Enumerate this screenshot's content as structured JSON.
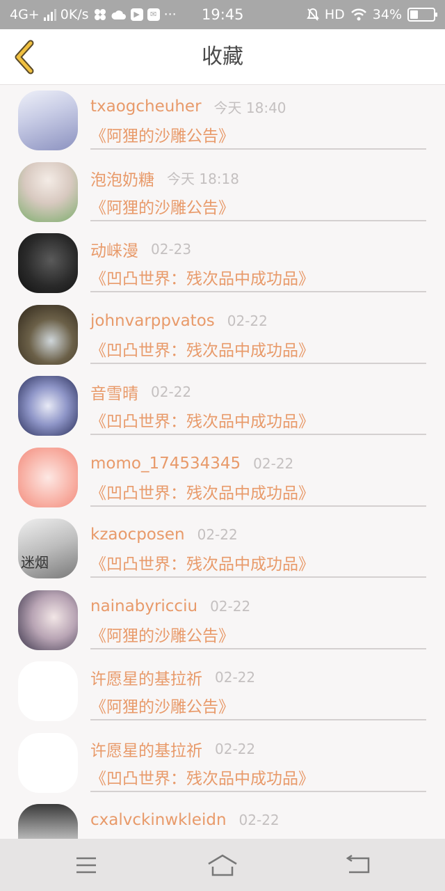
{
  "status_bar": {
    "network": "4G+",
    "speed": "0K/s",
    "more": "···",
    "time": "19:45",
    "hd": "HD",
    "battery": "34%",
    "battery_level": 0.34
  },
  "header": {
    "title": "收藏"
  },
  "favorites": [
    {
      "name": "txaogcheuher",
      "time": "今天 18:40",
      "work": "《阿狸的沙雕公告》",
      "avatar": "grad-a"
    },
    {
      "name": "泡泡奶糖",
      "time": "今天 18:18",
      "work": "《阿狸的沙雕公告》",
      "avatar": "grad-b"
    },
    {
      "name": "动崃漫",
      "time": "02-23",
      "work": "《凹凸世界：残次品中成功品》",
      "avatar": "grad-c"
    },
    {
      "name": "johnvarppvatos",
      "time": "02-22",
      "work": "《凹凸世界：残次品中成功品》",
      "avatar": "grad-d"
    },
    {
      "name": "音雪晴",
      "time": "02-22",
      "work": "《凹凸世界：残次品中成功品》",
      "avatar": "grad-e"
    },
    {
      "name": "momo_174534345",
      "time": "02-22",
      "work": "《凹凸世界：残次品中成功品》",
      "avatar": "grad-f"
    },
    {
      "name": "kzaocposen",
      "time": "02-22",
      "work": "《凹凸世界：残次品中成功品》",
      "avatar": "grad-g",
      "avatar_text": "迷烟"
    },
    {
      "name": "nainabyricciu",
      "time": "02-22",
      "work": "《阿狸的沙雕公告》",
      "avatar": "grad-h"
    },
    {
      "name": "许愿星的基拉祈",
      "time": "02-22",
      "work": "《阿狸的沙雕公告》",
      "avatar": "grad-blank"
    },
    {
      "name": "许愿星的基拉祈",
      "time": "02-22",
      "work": "《凹凸世界：残次品中成功品》",
      "avatar": "grad-blank"
    },
    {
      "name": "cxalvckinwkleidn",
      "time": "02-22",
      "work": "",
      "avatar": "grad-i"
    }
  ],
  "nav": {
    "menu_icon": "menu-icon",
    "home_icon": "home-icon",
    "back_icon": "return-icon"
  },
  "colors": {
    "accent": "#e89a6a",
    "status_bar": "#a8a8a8",
    "back_arrow": "#e8b830"
  }
}
